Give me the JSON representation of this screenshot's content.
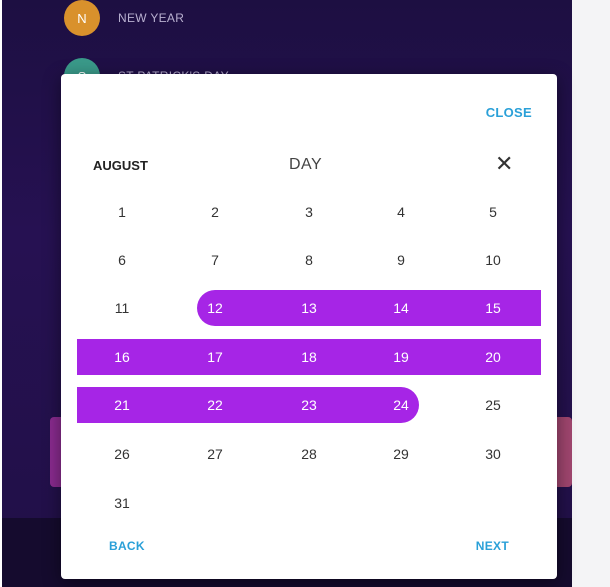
{
  "background": {
    "list": [
      {
        "label": "NEW YEAR",
        "avatar_text": "N",
        "avatar_color": "#d9912c"
      },
      {
        "label": "ST PATRICK'S DAY",
        "avatar_text": "S",
        "avatar_color": "#3a9a8a"
      }
    ]
  },
  "dialog": {
    "close_label": "CLOSE",
    "month": "AUGUST",
    "mode": "DAY",
    "dismiss_symbol": "✕",
    "back_label": "BACK",
    "next_label": "NEXT",
    "selection_color": "#a625e6",
    "accent_color": "#2aa0d8",
    "selected_range": {
      "start": "12",
      "end": "24"
    },
    "weeks": [
      [
        "1",
        "2",
        "3",
        "4",
        "5"
      ],
      [
        "6",
        "7",
        "8",
        "9",
        "10"
      ],
      [
        "11",
        "12",
        "13",
        "14",
        "15"
      ],
      [
        "16",
        "17",
        "18",
        "19",
        "20"
      ],
      [
        "21",
        "22",
        "23",
        "24",
        "25"
      ],
      [
        "26",
        "27",
        "28",
        "29",
        "30"
      ],
      [
        "31"
      ]
    ]
  }
}
